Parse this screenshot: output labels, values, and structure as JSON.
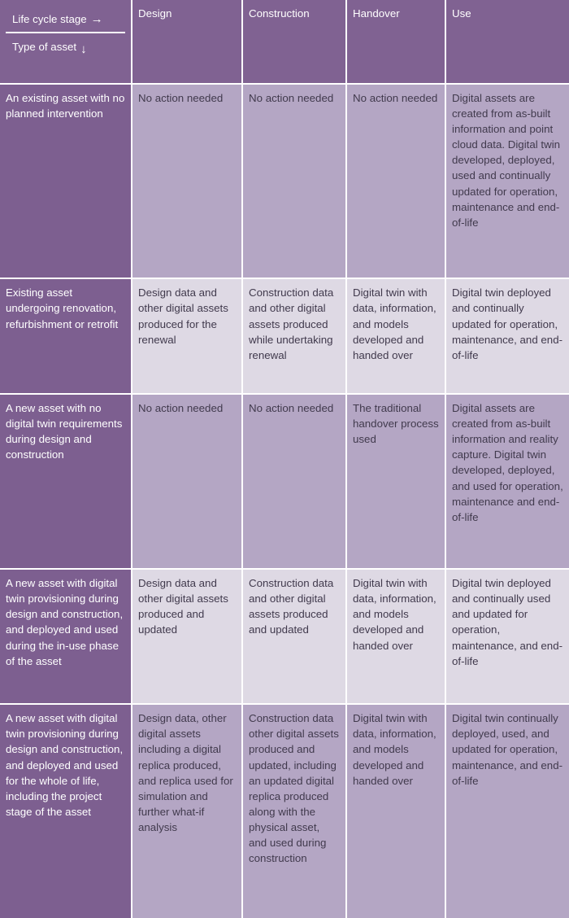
{
  "table": {
    "corner": {
      "top_label": "Life cycle stage",
      "top_arrow": "→",
      "bottom_label": "Type of asset",
      "bottom_arrow": "↓"
    },
    "columns": [
      "Design",
      "Construction",
      "Handover",
      "Use"
    ],
    "rows": [
      {
        "label": "An existing asset with no planned intervention",
        "tint": "dark",
        "cells": [
          "No action needed",
          "No action needed",
          "No action needed",
          "Digital assets are created from as-built information and point cloud data. Digital twin developed, deployed, used and continually updated for operation, maintenance and end-of-life"
        ]
      },
      {
        "label": "Existing asset undergoing renovation, refurbishment or retrofit",
        "tint": "light",
        "cells": [
          "Design data and other digital assets produced for the renewal",
          "Construction data and other digital assets produced while undertaking renewal",
          "Digital twin with data, information, and models developed and handed over",
          "Digital twin deployed and continually updated for operation, maintenance, and end-of-life"
        ]
      },
      {
        "label": "A new asset with no digital twin requirements during design and construction",
        "tint": "dark",
        "cells": [
          "No action needed",
          "No action needed",
          "The traditional handover process used",
          "Digital assets are created from as-built information and reality capture. Digital twin developed, deployed, and used for operation, maintenance and end-of-life"
        ]
      },
      {
        "label": "A new asset with digital twin provisioning during design and construction, and deployed and used during the in-use phase of the asset",
        "tint": "light",
        "cells": [
          "Design data and other digital assets produced and updated",
          "Construction data and other digital assets produced and updated",
          "Digital twin with data, information, and models developed and handed over",
          "Digital twin deployed and continually used and updated for operation, maintenance, and end-of-life"
        ]
      },
      {
        "label": "A new asset with digital twin provisioning during design and construction, and deployed and used for the whole of life, including the project stage of the asset",
        "tint": "dark",
        "cells": [
          "Design data, other digital assets including a digital replica produced, and replica used for simulation and further what-if analysis",
          "Construction data other digital assets produced and updated, including an updated digital replica produced along with the physical asset, and used during construction",
          "Digital twin with data, information, and models developed and handed over",
          "Digital twin continually deployed, used, and updated for operation, maintenance, and end-of-life"
        ]
      }
    ]
  },
  "colors": {
    "header_purple": "#806292",
    "row_label_purple": "#7d5f90",
    "cell_dark": "#b4a6c4",
    "cell_light": "#ded9e4",
    "grid_line": "#ffffff",
    "header_text": "#ffffff",
    "body_text": "#413a4d"
  }
}
